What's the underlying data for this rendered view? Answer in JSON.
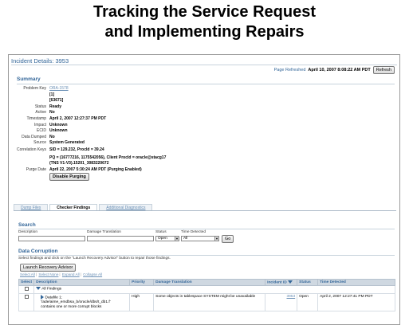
{
  "slide": {
    "title_line1": "Tracking the Service Request",
    "title_line2": "and Implementing Repairs"
  },
  "header": {
    "incident_title": "Incident Details: 3953",
    "page_refreshed_label": "Page Refreshed",
    "page_refreshed_value": "April 10, 2007 8:08:22 AM PDT",
    "refresh_button": "Refresh"
  },
  "summary": {
    "heading": "Summary",
    "rows": [
      {
        "key": "Problem Key",
        "value": "ORA-1578"
      },
      {
        "key": "",
        "value": "[1]"
      },
      {
        "key": "",
        "value": "[63671]"
      },
      {
        "key": "Status",
        "value": "Ready"
      },
      {
        "key": "Active",
        "value": "No"
      },
      {
        "key": "Timestamp",
        "value": "April 2, 2007 12:27:37 PM PDT"
      },
      {
        "key": "Impact",
        "value": "Unknown"
      },
      {
        "key": "ECID",
        "value": "Unknown"
      },
      {
        "key": "Data Dumped",
        "value": "No"
      },
      {
        "key": "Source",
        "value": "System Generated"
      }
    ],
    "correlation_label": "Correlation Keys",
    "correlation_line1": "SID = 129.232, ProcId = 39.24",
    "correlation_line2": "PQ = (16777216, 1175542056), Client ProcId = oracle@stacg17",
    "correlation_line3": "(TNS V1-V3).15201_3083220672",
    "purge_label": "Purge Date",
    "purge_value": "April 22, 2007 5:30:24 AM PDT (Purging Enabled)",
    "disable_purging": "Disable Purging"
  },
  "tabs": [
    "Dump Files",
    "Checker Findings",
    "Additional Diagnostics"
  ],
  "search": {
    "heading": "Search",
    "description_label": "Description",
    "damage_label": "Damage Translation",
    "status_label": "Status",
    "time_label": "Time Detected",
    "status_value": "Open",
    "time_value": "All",
    "go_button": "Go"
  },
  "corruption": {
    "heading": "Data Corruption",
    "hint": "Select findings and click on the \"Launch Recovery Advisor\" button to repair those findings.",
    "launch_button": "Launch Recovery Advisor",
    "select_all": "Select All",
    "select_none": "Select None",
    "expand_all": "Expand All",
    "collapse_all": "Collapse All",
    "columns": [
      "Select",
      "Description",
      "Priority",
      "Damage Translation",
      "Incident ID",
      "Status",
      "Time Detected"
    ],
    "all_findings": "All Findings",
    "row": {
      "description_line1": "Datafile 1:",
      "description_line2": "'/ade/aime_emdbsa_b/oracle/dbs/t_db1.f'",
      "description_line3": "contains one or more corrupt blocks",
      "priority": "High",
      "damage": "Some objects in tablespace SYSTEM might be unavailable",
      "incident_id": "3953",
      "status": "Open",
      "time": "April 2, 2007 12:27:41 PM PDT"
    }
  }
}
